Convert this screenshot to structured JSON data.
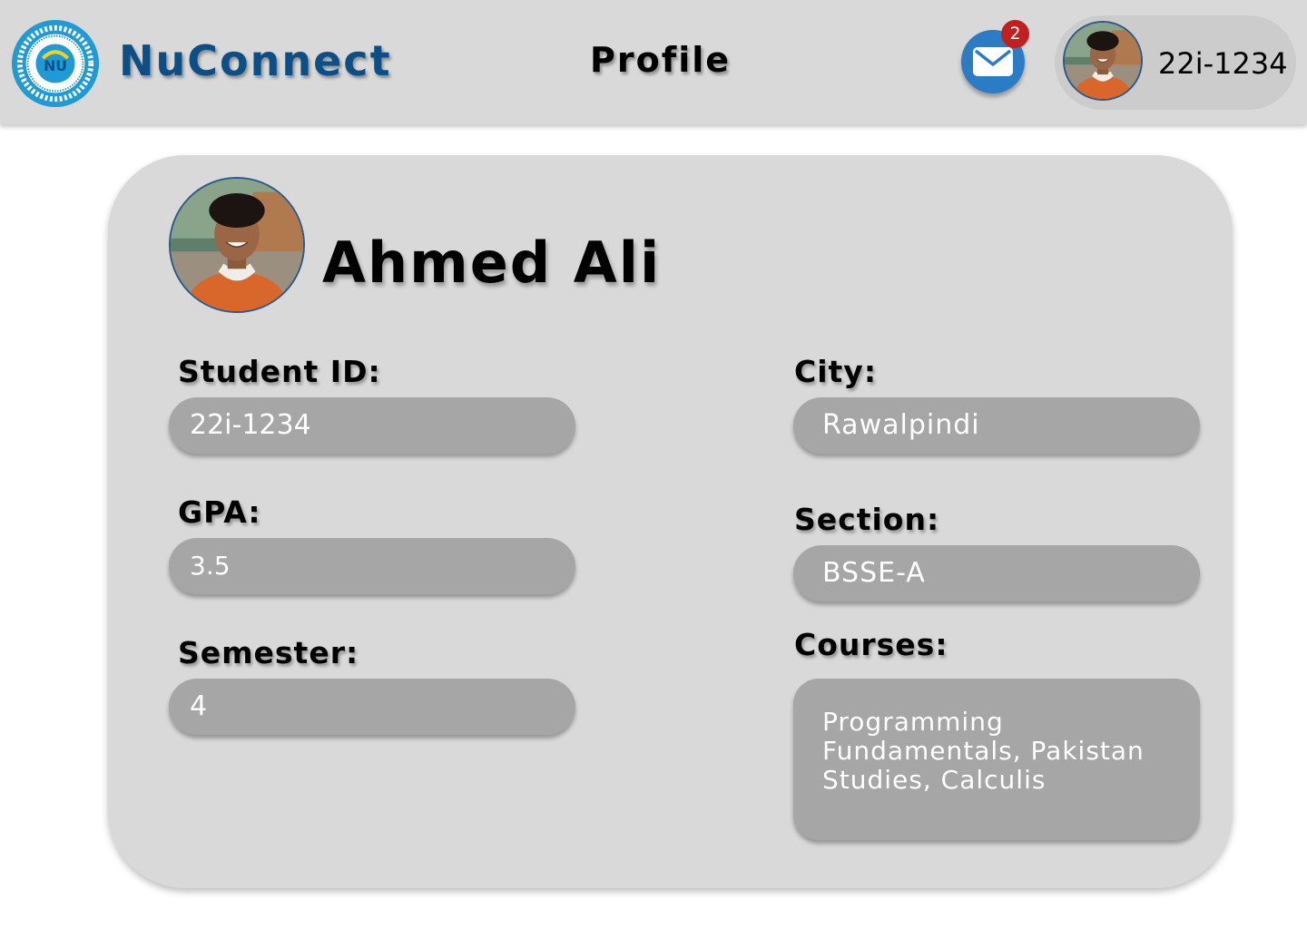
{
  "header": {
    "app_name": "NuConnect",
    "page_title": "Profile",
    "notifications": {
      "count": "2",
      "icon": "mail-icon"
    },
    "user": {
      "id": "22i-1234"
    },
    "logo": {
      "icon": "university-seal-icon",
      "text": "NU",
      "colors": {
        "ring": "#1e9ad6",
        "brand": "#0b4f86"
      }
    }
  },
  "profile": {
    "name": "Ahmed Ali",
    "fields": {
      "student_id": {
        "label": "Student ID:",
        "value": "22i-1234"
      },
      "gpa": {
        "label": "GPA:",
        "value": "3.5"
      },
      "semester": {
        "label": "Semester:",
        "value": "4"
      },
      "city": {
        "label": "City:",
        "value": "Rawalpindi"
      },
      "section": {
        "label": "Section:",
        "value": "BSSE-A"
      },
      "courses": {
        "label": "Courses:",
        "value": "Programming Fundamentals, Pakistan Studies, Calculis"
      }
    }
  },
  "colors": {
    "header_bg": "#d9d9d9",
    "card_bg": "#d9d9d9",
    "field_bg": "#a6a6a6",
    "accent_blue": "#2a7cc4",
    "badge_red": "#c21f1f"
  }
}
